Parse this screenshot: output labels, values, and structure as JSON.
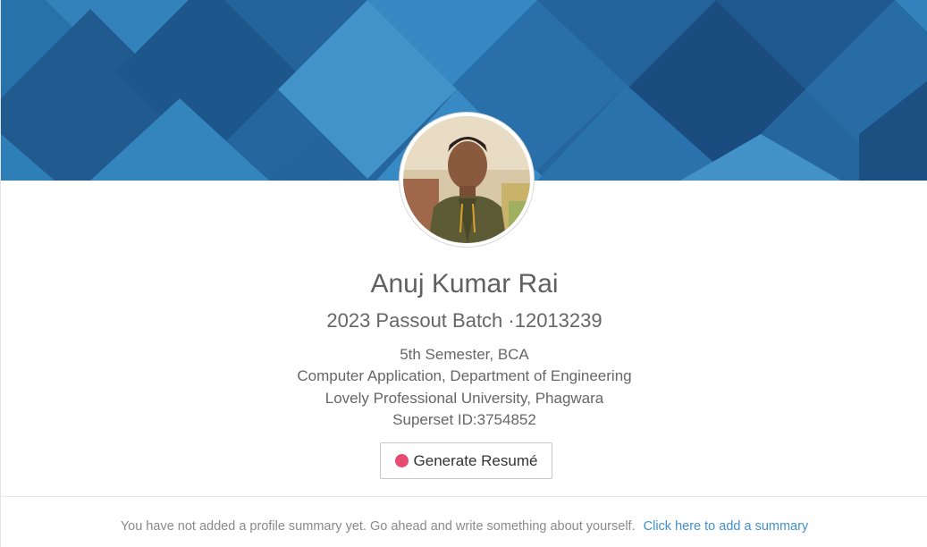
{
  "profile": {
    "name": "Anuj Kumar Rai",
    "batch": "2023 Passout Batch ·12013239",
    "semester": "5th Semester, BCA",
    "department": "Computer Application, Department of Engineering",
    "university": "Lovely Professional University, Phagwara",
    "superset_id": "Superset ID:3754852"
  },
  "actions": {
    "generate_resume_label": "Generate Resumé",
    "generate_resume_icon": "pink-dot-icon"
  },
  "summary": {
    "empty_text": "You have not added a profile summary yet. Go ahead and write something about yourself.",
    "add_link": "Click here to add a summary"
  },
  "colors": {
    "cover_blue": "#2a6ea7",
    "link_blue": "#3f8fd2",
    "dot_pink": "#e84a72"
  }
}
